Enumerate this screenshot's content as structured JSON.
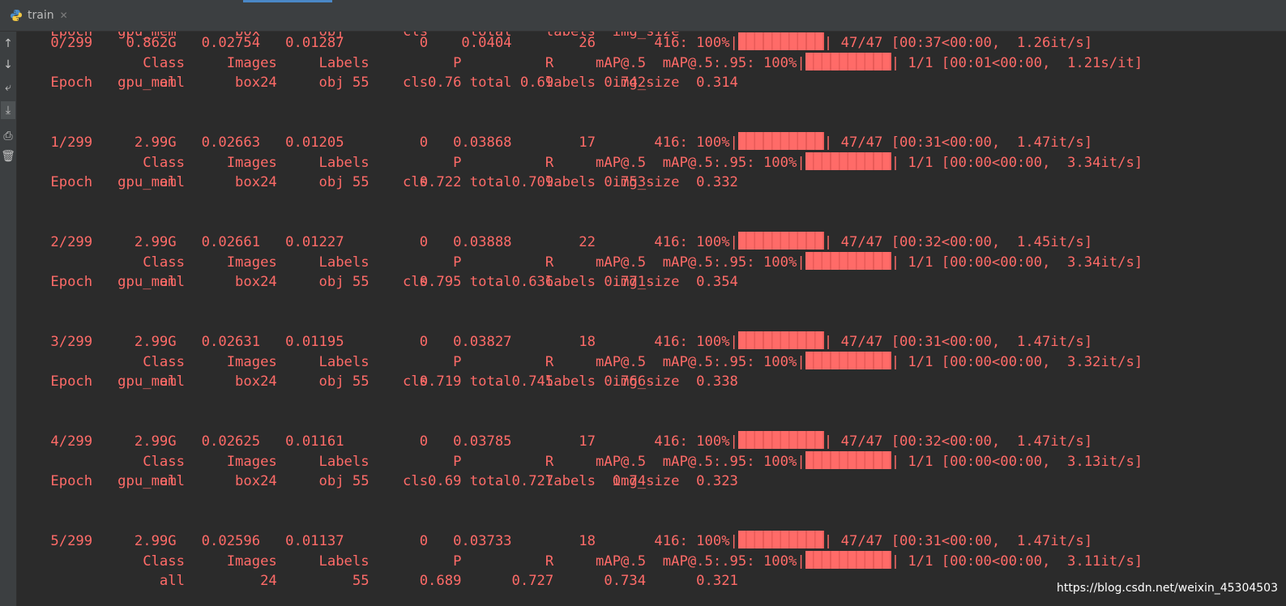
{
  "tab": {
    "title": "train",
    "close_glyph": "✕",
    "icon": "python-icon"
  },
  "toolbar": [
    {
      "name": "scroll-up-button",
      "glyph": "↑"
    },
    {
      "name": "scroll-down-button",
      "glyph": "↓"
    },
    {
      "name": "soft-wrap-button",
      "glyph": "⤶"
    },
    {
      "name": "scroll-to-end-button",
      "glyph": "⤓"
    },
    {
      "name": "print-button",
      "glyph": "⎙"
    },
    {
      "name": "clear-all-button",
      "glyph": "🗑"
    }
  ],
  "colors": {
    "output": "#ff6b68",
    "background": "#2b2b2b"
  },
  "console": {
    "partial_header": "    Epoch   gpu_mem       box       obj       cls     total    labels  img_size",
    "epochs": [
      {
        "header": "    Epoch   gpu_mem       box       obj       cls     total    labels  img_size",
        "train": "    0/299    0.862G   0.02754   0.01287         0    0.0404        26       416: 100%|",
        "train_tail": "| 47/47 [00:37<00:00,  1.26it/s]",
        "class": "               Class     Images     Labels          P          R     mAP@.5  mAP@.5:.95: 100%|",
        "class_tail": "| 1/1 [00:01<00:00,  1.21s/it]",
        "all": "                 all         24         55       0.76       0.69      0.742      0.314"
      },
      {
        "header": "    Epoch   gpu_mem       box       obj       cls     total    labels  img_size",
        "train": "    1/299     2.99G   0.02663   0.01205         0   0.03868        17       416: 100%|",
        "train_tail": "| 47/47 [00:31<00:00,  1.47it/s]",
        "class": "               Class     Images     Labels          P          R     mAP@.5  mAP@.5:.95: 100%|",
        "class_tail": "| 1/1 [00:00<00:00,  3.34it/s]",
        "all": "                 all         24         55      0.722      0.709      0.753      0.332"
      },
      {
        "header": "    Epoch   gpu_mem       box       obj       cls     total    labels  img_size",
        "train": "    2/299     2.99G   0.02661   0.01227         0   0.03888        22       416: 100%|",
        "train_tail": "| 47/47 [00:32<00:00,  1.45it/s]",
        "class": "               Class     Images     Labels          P          R     mAP@.5  mAP@.5:.95: 100%|",
        "class_tail": "| 1/1 [00:00<00:00,  3.34it/s]",
        "all": "                 all         24         55      0.795      0.636      0.771      0.354"
      },
      {
        "header": "    Epoch   gpu_mem       box       obj       cls     total    labels  img_size",
        "train": "    3/299     2.99G   0.02631   0.01195         0   0.03827        18       416: 100%|",
        "train_tail": "| 47/47 [00:31<00:00,  1.47it/s]",
        "class": "               Class     Images     Labels          P          R     mAP@.5  mAP@.5:.95: 100%|",
        "class_tail": "| 1/1 [00:00<00:00,  3.32it/s]",
        "all": "                 all         24         55      0.719      0.745      0.766      0.338"
      },
      {
        "header": "    Epoch   gpu_mem       box       obj       cls     total    labels  img_size",
        "train": "    4/299     2.99G   0.02625   0.01161         0   0.03785        17       416: 100%|",
        "train_tail": "| 47/47 [00:32<00:00,  1.47it/s]",
        "class": "               Class     Images     Labels          P          R     mAP@.5  mAP@.5:.95: 100%|",
        "class_tail": "| 1/1 [00:00<00:00,  3.13it/s]",
        "all": "                 all         24         55       0.69      0.727       0.74      0.323"
      },
      {
        "header": "    Epoch   gpu_mem       box       obj       cls     total    labels  img_size",
        "train": "    5/299     2.99G   0.02596   0.01137         0   0.03733        18       416: 100%|",
        "train_tail": "| 47/47 [00:31<00:00,  1.47it/s]",
        "class": "               Class     Images     Labels          P          R     mAP@.5  mAP@.5:.95: 100%|",
        "class_tail": "| 1/1 [00:00<00:00,  3.11it/s]",
        "all": "                 all         24         55      0.689      0.727      0.734      0.321"
      }
    ]
  },
  "watermark": "https://blog.csdn.net/weixin_45304503"
}
